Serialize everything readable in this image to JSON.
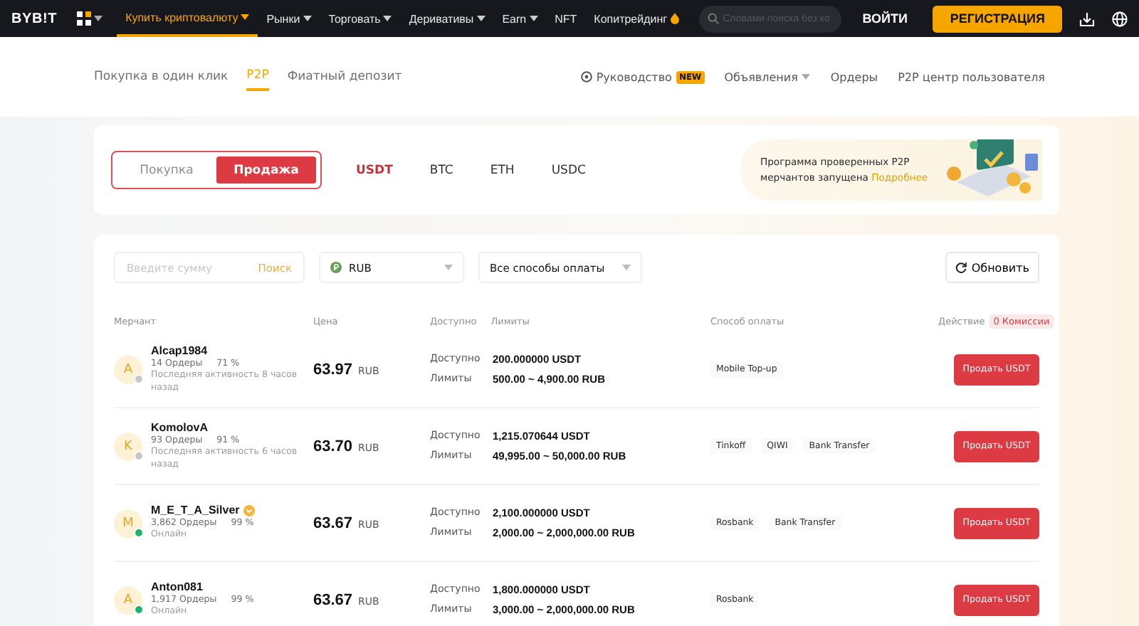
{
  "nav": {
    "logo": "BYB!T",
    "items": [
      {
        "label": "Купить криптовалюту",
        "selected": true,
        "dropdown": true
      },
      {
        "label": "Рынки",
        "selected": false,
        "dropdown": true
      },
      {
        "label": "Торговать",
        "selected": false,
        "dropdown": true
      },
      {
        "label": "Деривативы",
        "selected": false,
        "dropdown": true
      },
      {
        "label": "Earn",
        "selected": false,
        "dropdown": true
      },
      {
        "label": "NFT",
        "selected": false,
        "dropdown": false
      },
      {
        "label": "Копитрейдинг",
        "selected": false,
        "dropdown": false,
        "hot": true
      }
    ],
    "search": {
      "placeholder": "Словами поиска без ко"
    },
    "login": "ВОЙТИ",
    "register": "РЕГИСТРАЦИЯ"
  },
  "subnav": {
    "tabs": [
      {
        "label": "Покупка в один клик",
        "selected": false
      },
      {
        "label": "P2P",
        "selected": true
      },
      {
        "label": "Фиатный депозит",
        "selected": false
      }
    ],
    "links": [
      {
        "label": "Руководство",
        "kind": "guide",
        "badge": "NEW"
      },
      {
        "label": "Объявления",
        "kind": "dropdown"
      },
      {
        "label": "Ордеры",
        "kind": "plain"
      },
      {
        "label": "P2P центр пользователя",
        "kind": "plain"
      }
    ]
  },
  "side": [
    {
      "label": "Покупка",
      "selected": false
    },
    {
      "label": "Продажа",
      "selected": true
    }
  ],
  "coins": [
    {
      "label": "USDT",
      "selected": true
    },
    {
      "label": "BTC",
      "selected": false
    },
    {
      "label": "ETH",
      "selected": false
    },
    {
      "label": "USDC",
      "selected": false
    }
  ],
  "banner": {
    "text": "Программа проверенных P2P мерчантов запущена",
    "link": "Подробнее"
  },
  "filters": {
    "amount": {
      "placeholder": "Введите сумму"
    },
    "search": "Поиск",
    "currency": "RUB",
    "payment": "Все способы оплаты",
    "refresh": "Обновить"
  },
  "table": {
    "columns": [
      "Мерчант",
      "Цена",
      "Доступно",
      "Лимиты",
      "Способ оплаты",
      "Действие"
    ],
    "fee_badge": "0 Комиссии",
    "rows": [
      {
        "initial": "A",
        "name": "Alcap1984",
        "verified": false,
        "online": false,
        "orders": "14 Ордеры",
        "rate": "71 %",
        "status": "Последняя активность 8 часов назад",
        "price": "63.97",
        "currency": "RUB",
        "available_label": "Доступно",
        "available": "200.000000 USDT",
        "limits_label": "Лимиты",
        "limits": "500.00 ~ 4,900.00 RUB",
        "payments": [
          "Mobile Top-up"
        ],
        "action": "Продать USDT"
      },
      {
        "initial": "K",
        "name": "KomolovA",
        "verified": false,
        "online": false,
        "orders": "93 Ордеры",
        "rate": "91 %",
        "status": "Последняя активность 6 часов назад",
        "price": "63.70",
        "currency": "RUB",
        "available_label": "Доступно",
        "available": "1,215.070644 USDT",
        "limits_label": "Лимиты",
        "limits": "49,995.00 ~ 50,000.00 RUB",
        "payments": [
          "Tinkoff",
          "QIWI",
          "Bank Transfer"
        ],
        "action": "Продать USDT"
      },
      {
        "initial": "M",
        "name": "M_E_T_A_Silver",
        "verified": true,
        "online": true,
        "orders": "3,862 Ордеры",
        "rate": "99 %",
        "status": "Онлайн",
        "price": "63.67",
        "currency": "RUB",
        "available_label": "Доступно",
        "available": "2,100.000000 USDT",
        "limits_label": "Лимиты",
        "limits": "2,000.00 ~ 2,000,000.00 RUB",
        "payments": [
          "Rosbank",
          "Bank Transfer"
        ],
        "action": "Продать USDT"
      },
      {
        "initial": "A",
        "name": "Anton081",
        "verified": false,
        "online": true,
        "orders": "1,917 Ордеры",
        "rate": "99 %",
        "status": "Онлайн",
        "price": "63.67",
        "currency": "RUB",
        "available_label": "Доступно",
        "available": "1,800.000000 USDT",
        "limits_label": "Лимиты",
        "limits": "3,000.00 ~ 2,000,000.00 RUB",
        "payments": [
          "Rosbank"
        ],
        "action": "Продать USDT"
      }
    ]
  }
}
